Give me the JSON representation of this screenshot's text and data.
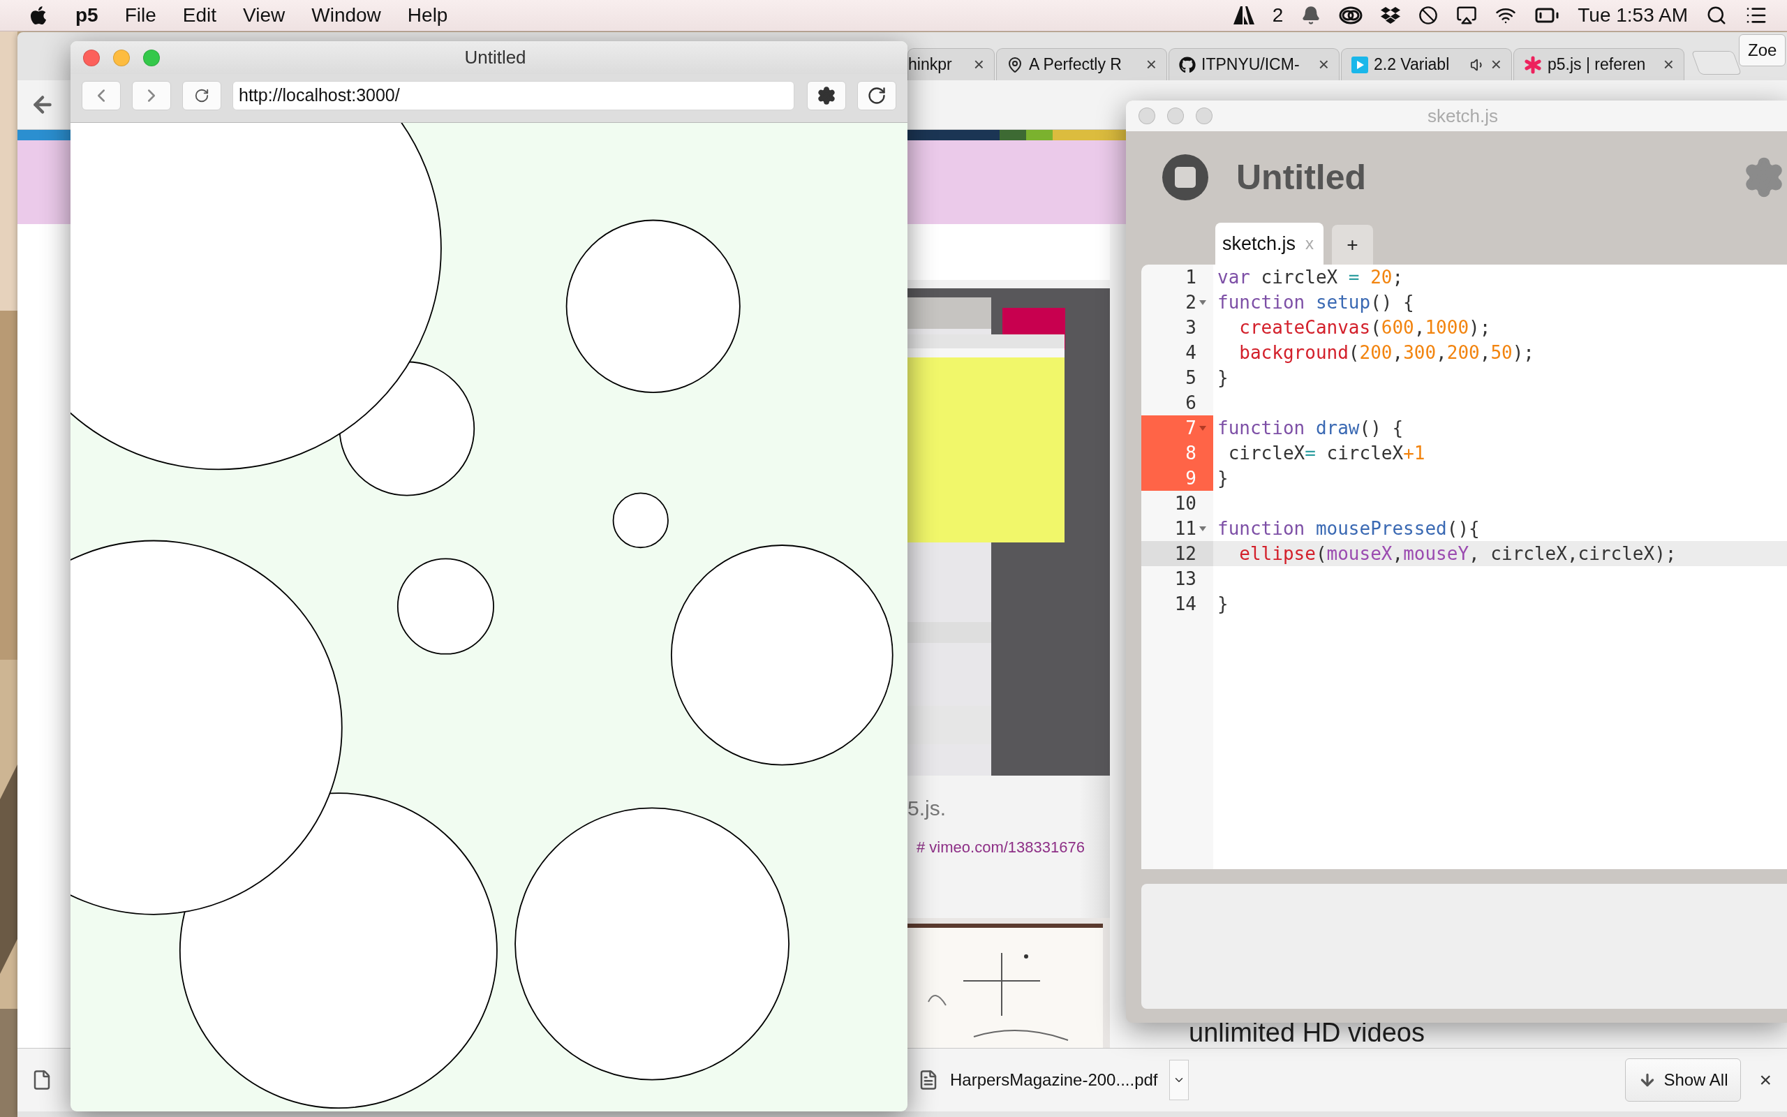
{
  "menu_bar": {
    "app_name": "p5",
    "menus": [
      "File",
      "Edit",
      "View",
      "Window",
      "Help"
    ],
    "notification_count": "2",
    "clock": "Tue 1:53 AM"
  },
  "browser": {
    "tabs": [
      {
        "title": "hinkpr",
        "close": "×",
        "kind": "plain",
        "audio": false
      },
      {
        "title": "A Perfectly R",
        "close": "×",
        "kind": "pin",
        "audio": false
      },
      {
        "title": "ITPNYU/ICM-",
        "close": "×",
        "kind": "github",
        "audio": false
      },
      {
        "title": "2.2 Variabl",
        "close": "×",
        "kind": "play",
        "audio": true
      },
      {
        "title": "p5.js | referen",
        "close": "×",
        "kind": "asterisk",
        "audio": false
      }
    ],
    "profile": "Zoe",
    "page": {
      "caption": "5.js.",
      "link": "# vimeo.com/138331676",
      "promo": "unlimited HD videos"
    },
    "downloads": {
      "file": "HarpersMagazine-200....pdf",
      "show_all": "Show All",
      "close": "×"
    }
  },
  "preview": {
    "title": "Untitled",
    "url": "http://localhost:3000/"
  },
  "editor": {
    "title": "sketch.js",
    "sketch_name": "Untitled",
    "tabs": [
      {
        "label": "sketch.js",
        "close": "x",
        "selected": true
      }
    ],
    "add_tab": "+",
    "lines": [
      {
        "number": "1",
        "fold": false,
        "error": false,
        "active": false,
        "tokens": [
          {
            "kind": "keyword",
            "text": "var"
          },
          {
            "kind": "plain",
            "text": " circleX "
          },
          {
            "kind": "operator",
            "text": "="
          },
          {
            "kind": "number",
            "text": " 20"
          },
          {
            "kind": "plain",
            "text": ";"
          }
        ]
      },
      {
        "number": "2",
        "fold": true,
        "error": false,
        "active": false,
        "tokens": [
          {
            "kind": "keyword",
            "text": "function"
          },
          {
            "kind": "def",
            "text": " setup"
          },
          {
            "kind": "plain",
            "text": "() {"
          }
        ]
      },
      {
        "number": "3",
        "fold": false,
        "error": false,
        "active": false,
        "tokens": [
          {
            "kind": "builtin",
            "text": "  createCanvas"
          },
          {
            "kind": "plain",
            "text": "("
          },
          {
            "kind": "number",
            "text": "600"
          },
          {
            "kind": "plain",
            "text": ","
          },
          {
            "kind": "number",
            "text": "1000"
          },
          {
            "kind": "plain",
            "text": ");"
          }
        ]
      },
      {
        "number": "4",
        "fold": false,
        "error": false,
        "active": false,
        "tokens": [
          {
            "kind": "builtin",
            "text": "  background"
          },
          {
            "kind": "plain",
            "text": "("
          },
          {
            "kind": "number",
            "text": "200"
          },
          {
            "kind": "plain",
            "text": ","
          },
          {
            "kind": "number",
            "text": "300"
          },
          {
            "kind": "plain",
            "text": ","
          },
          {
            "kind": "number",
            "text": "200"
          },
          {
            "kind": "plain",
            "text": ","
          },
          {
            "kind": "number",
            "text": "50"
          },
          {
            "kind": "plain",
            "text": ");"
          }
        ]
      },
      {
        "number": "5",
        "fold": false,
        "error": false,
        "active": false,
        "tokens": [
          {
            "kind": "plain",
            "text": "}"
          }
        ]
      },
      {
        "number": "6",
        "fold": false,
        "error": false,
        "active": false
      },
      {
        "number": "7",
        "fold": true,
        "error": true,
        "active": false,
        "tokens": [
          {
            "kind": "keyword",
            "text": "function"
          },
          {
            "kind": "def",
            "text": " draw"
          },
          {
            "kind": "plain",
            "text": "() {"
          }
        ]
      },
      {
        "number": "8",
        "fold": false,
        "error": true,
        "active": false,
        "tokens": [
          {
            "kind": "plain",
            "text": " circleX"
          },
          {
            "kind": "operator",
            "text": "="
          },
          {
            "kind": "plain",
            "text": " circleX"
          },
          {
            "kind": "number",
            "text": "+1"
          }
        ]
      },
      {
        "number": "9",
        "fold": false,
        "error": true,
        "active": false,
        "tokens": [
          {
            "kind": "plain",
            "text": "}"
          }
        ]
      },
      {
        "number": "10",
        "fold": false,
        "error": false,
        "active": false
      },
      {
        "number": "11",
        "fold": true,
        "error": false,
        "active": false,
        "tokens": [
          {
            "kind": "keyword",
            "text": "function"
          },
          {
            "kind": "def",
            "text": " mousePressed"
          },
          {
            "kind": "plain",
            "text": "(){"
          }
        ]
      },
      {
        "number": "12",
        "fold": false,
        "error": false,
        "active": true,
        "tokens": [
          {
            "kind": "builtin",
            "text": "  ellipse"
          },
          {
            "kind": "plain",
            "text": "("
          },
          {
            "kind": "variable",
            "text": "mouseX"
          },
          {
            "kind": "plain",
            "text": ","
          },
          {
            "kind": "variable",
            "text": "mouseY"
          },
          {
            "kind": "plain",
            "text": ", circleX,circleX);"
          }
        ]
      },
      {
        "number": "13",
        "fold": false,
        "error": false,
        "active": false
      },
      {
        "number": "14",
        "fold": false,
        "error": false,
        "active": false,
        "tokens": [
          {
            "kind": "plain",
            "text": "}"
          }
        ]
      }
    ]
  }
}
